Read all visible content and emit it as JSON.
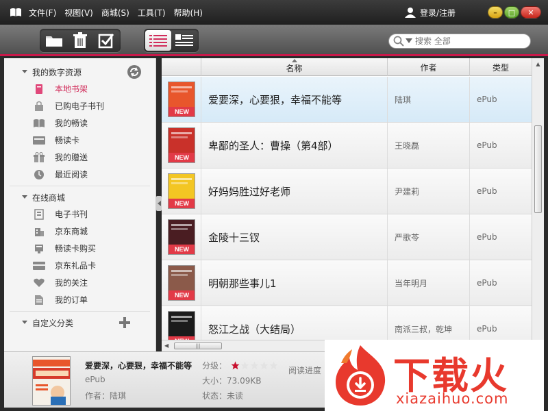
{
  "menu": [
    "文件(F)",
    "视图(V)",
    "商城(S)",
    "工具(T)",
    "帮助(H)"
  ],
  "login_text": "登录/注册",
  "window_buttons": {
    "minimize": "–",
    "maximize": "□",
    "close": "✕"
  },
  "search": {
    "placeholder": "搜索 全部"
  },
  "sidebar": {
    "section1": "我的数字资源",
    "items1": [
      {
        "label": "本地书架",
        "icon": "book-icon",
        "active": true
      },
      {
        "label": "已购电子书刊",
        "icon": "bag-icon"
      },
      {
        "label": "我的畅读",
        "icon": "open-book-icon"
      },
      {
        "label": "畅读卡",
        "icon": "card-icon"
      },
      {
        "label": "我的赠送",
        "icon": "gift-icon"
      },
      {
        "label": "最近阅读",
        "icon": "clock-icon"
      }
    ],
    "section2": "在线商城",
    "items2": [
      {
        "label": "电子书刊",
        "icon": "ebook-icon"
      },
      {
        "label": "京东商城",
        "icon": "building-icon"
      },
      {
        "label": "畅读卡购买",
        "icon": "cart-card-icon"
      },
      {
        "label": "京东礼品卡",
        "icon": "gift-card-icon"
      },
      {
        "label": "我的关注",
        "icon": "heart-icon"
      },
      {
        "label": "我的订单",
        "icon": "document-icon"
      }
    ],
    "section3": "自定义分类"
  },
  "table": {
    "headers": {
      "name": "名称",
      "author": "作者",
      "type": "类型"
    },
    "badge": "NEW",
    "rows": [
      {
        "name": "爱要深，心要狠，幸福不能等",
        "author": "陆琪",
        "type": "ePub",
        "cover_color": "#e8562c"
      },
      {
        "name": "卑鄙的圣人：曹操（第4部）",
        "author": "王晓磊",
        "type": "ePub",
        "cover_color": "#c9312a"
      },
      {
        "name": "好妈妈胜过好老师",
        "author": "尹建莉",
        "type": "ePub",
        "cover_color": "#f3c623"
      },
      {
        "name": "金陵十三钗",
        "author": "严歌苓",
        "type": "ePub",
        "cover_color": "#4a1d22"
      },
      {
        "name": "明朝那些事儿1",
        "author": "当年明月",
        "type": "ePub",
        "cover_color": "#8b5a4a"
      },
      {
        "name": "怒江之战（大结局）",
        "author": "南派三叔，乾坤",
        "type": "ePub",
        "cover_color": "#1b1b1b"
      }
    ]
  },
  "bottom": {
    "title": "爱要深，心要狠，幸福不能等",
    "type": "ePub",
    "author": "作者：陆琪",
    "rating_label": "分级：",
    "rating": 1,
    "rating_max": 5,
    "size": "大小：73.09KB",
    "status": "状态：未读",
    "progress": "阅读进度"
  },
  "watermark": {
    "text": "下载火",
    "url": "xiazaihuo.com"
  },
  "colors": {
    "accent": "#c9184a",
    "active_text": "#d12c5a",
    "watermark": "#e8392d"
  }
}
